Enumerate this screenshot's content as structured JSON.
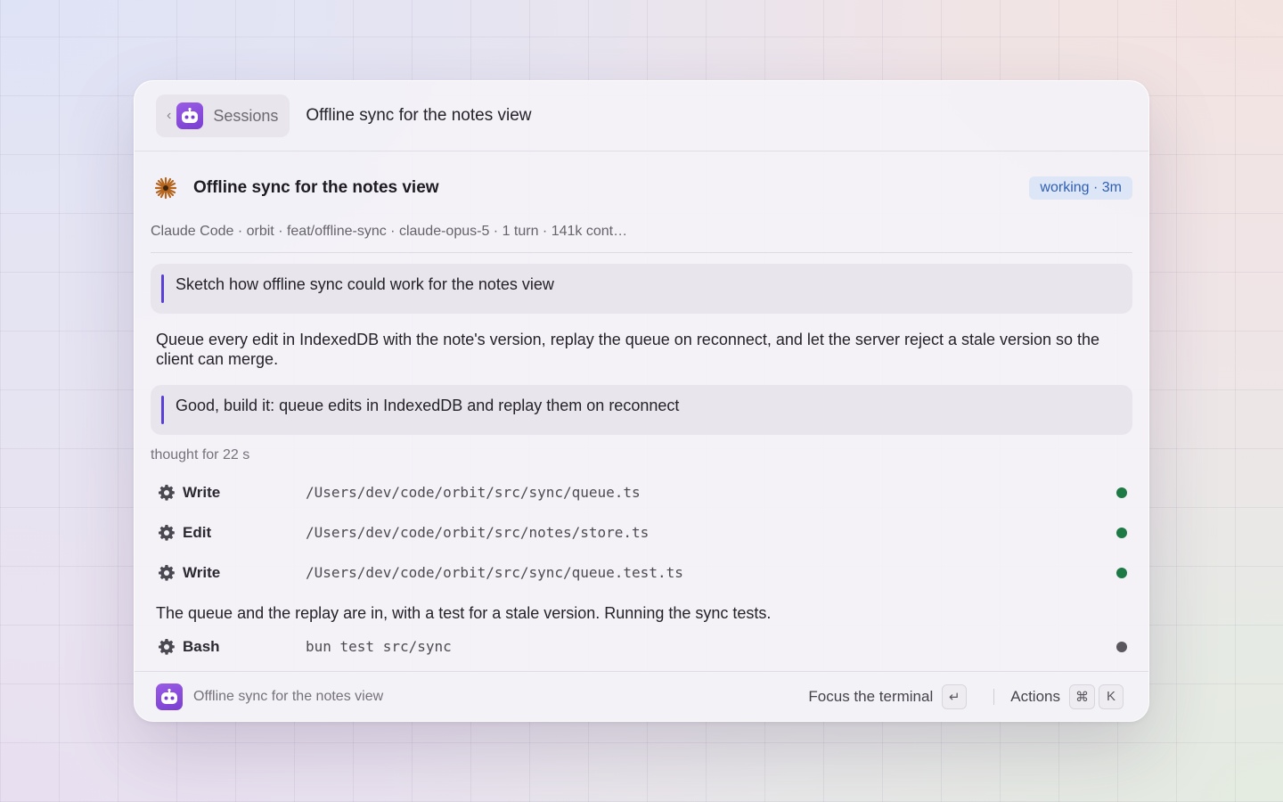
{
  "header": {
    "back_label": "Sessions",
    "title": "Offline sync for the notes view"
  },
  "session": {
    "title": "Offline sync for the notes view",
    "status": "working · 3m",
    "meta": "Claude Code · orbit · feat/offline-sync · claude-opus-5 · 1 turn · 141k cont…"
  },
  "messages": {
    "user1": "Sketch how offline sync could work for the notes view",
    "assistant1": "Queue every edit in IndexedDB with the note's version, replay the queue on reconnect, and let the server reject a stale version so the client can merge.",
    "user2": "Good, build it: queue edits in IndexedDB and replay them on reconnect",
    "thought": "thought for 22 s",
    "assistant2": "The queue and the replay are in, with a test for a stale version. Running the sync tests."
  },
  "tools": [
    {
      "name": "Write",
      "path": "/Users/dev/code/orbit/src/sync/queue.ts",
      "status_color": "#1e7a45"
    },
    {
      "name": "Edit",
      "path": "/Users/dev/code/orbit/src/notes/store.ts",
      "status_color": "#1e7a45"
    },
    {
      "name": "Write",
      "path": "/Users/dev/code/orbit/src/sync/queue.test.ts",
      "status_color": "#1e7a45"
    },
    {
      "name": "Bash",
      "path": "bun test src/sync",
      "status_color": "#5a585e"
    }
  ],
  "footer": {
    "title": "Offline sync for the notes view",
    "focus_label": "Focus the terminal",
    "focus_key": "↵",
    "actions_label": "Actions",
    "actions_key1": "⌘",
    "actions_key2": "K"
  },
  "colors": {
    "accent": "#5b3fd6",
    "app_icon": "#8a4fdc",
    "status_badge_bg": "#dde6f6",
    "status_badge_text": "#2f5fb3",
    "spark": "#b5651d"
  }
}
